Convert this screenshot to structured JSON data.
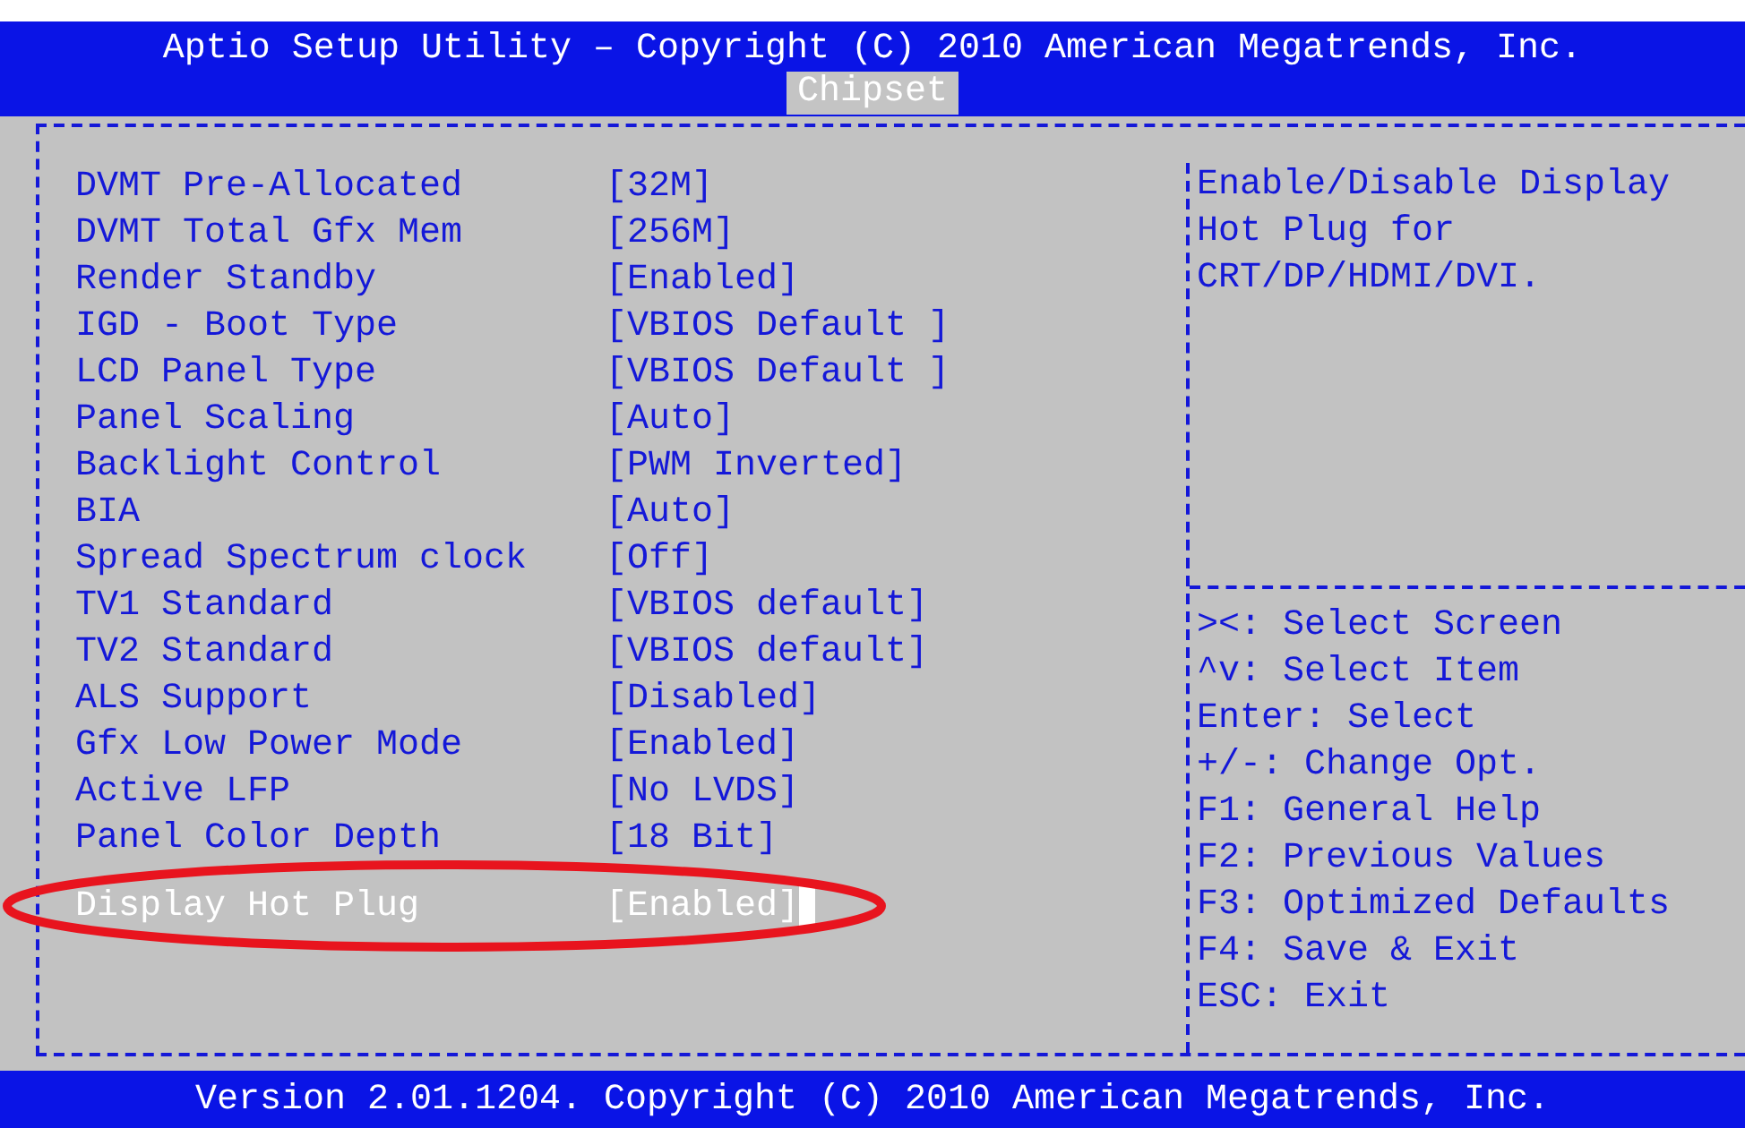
{
  "title": "Aptio Setup Utility – Copyright (C) 2010 American Megatrends, Inc.",
  "tabs": [
    {
      "label": "Chipset",
      "selected": true
    }
  ],
  "settings": [
    {
      "label": "DVMT Pre-Allocated",
      "value": "[32M]",
      "selected": false,
      "circled": false
    },
    {
      "label": "DVMT Total Gfx Mem",
      "value": "[256M]",
      "selected": false,
      "circled": false
    },
    {
      "label": "Render Standby",
      "value": "[Enabled]",
      "selected": false,
      "circled": false
    },
    {
      "label": "IGD - Boot Type",
      "value": "[VBIOS Default ]",
      "selected": false,
      "circled": false
    },
    {
      "label": "LCD Panel Type",
      "value": "[VBIOS Default ]",
      "selected": false,
      "circled": false
    },
    {
      "label": "Panel Scaling",
      "value": "[Auto]",
      "selected": false,
      "circled": false
    },
    {
      "label": "Backlight Control",
      "value": "[PWM Inverted]",
      "selected": false,
      "circled": false
    },
    {
      "label": "BIA",
      "value": "[Auto]",
      "selected": false,
      "circled": false
    },
    {
      "label": "Spread Spectrum clock",
      "value": "[Off]",
      "selected": false,
      "circled": false
    },
    {
      "label": "TV1 Standard",
      "value": "[VBIOS default]",
      "selected": false,
      "circled": false
    },
    {
      "label": "TV2 Standard",
      "value": "[VBIOS default]",
      "selected": false,
      "circled": false
    },
    {
      "label": "ALS Support",
      "value": "[Disabled]",
      "selected": false,
      "circled": false
    },
    {
      "label": "Gfx Low Power Mode",
      "value": "[Enabled]",
      "selected": false,
      "circled": false
    },
    {
      "label": "Active LFP",
      "value": "[No LVDS]",
      "selected": false,
      "circled": false
    },
    {
      "label": "Panel Color Depth",
      "value": "[18 Bit]",
      "selected": false,
      "circled": false
    },
    {
      "label": "Display Hot Plug",
      "value": "[Enabled]",
      "selected": true,
      "circled": true
    }
  ],
  "help_text": [
    "Enable/Disable Display",
    "Hot Plug for",
    "CRT/DP/HDMI/DVI."
  ],
  "key_hints": [
    "><: Select Screen",
    "^v: Select Item",
    "Enter: Select",
    "+/-: Change Opt.",
    "F1: General Help",
    "F2: Previous Values",
    "F3: Optimized Defaults",
    "F4: Save & Exit",
    "ESC: Exit"
  ],
  "footer": "Version 2.01.1204. Copyright (C) 2010 American Megatrends, Inc."
}
